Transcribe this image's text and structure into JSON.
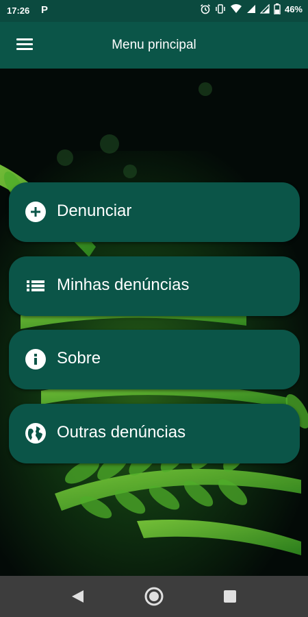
{
  "status_bar": {
    "time": "17:26",
    "notification_letter": "P",
    "battery_percent": "46%"
  },
  "app_bar": {
    "title": "Menu principal",
    "menu_icon": "hamburger-menu-icon"
  },
  "menu": {
    "items": [
      {
        "label": "Denunciar",
        "icon": "add-circle-icon"
      },
      {
        "label": "Minhas denúncias",
        "icon": "list-icon"
      },
      {
        "label": "Sobre",
        "icon": "info-icon"
      },
      {
        "label": "Outras denúncias",
        "icon": "globe-icon"
      }
    ]
  },
  "colors": {
    "primary": "#0b5548",
    "status_bar": "#0b4a3f",
    "nav_bar": "#3d3d3d",
    "text": "#ffffff"
  },
  "nav_bar": {
    "back_icon": "back-triangle-icon",
    "home_icon": "home-circle-icon",
    "recent_icon": "recent-apps-square-icon"
  }
}
